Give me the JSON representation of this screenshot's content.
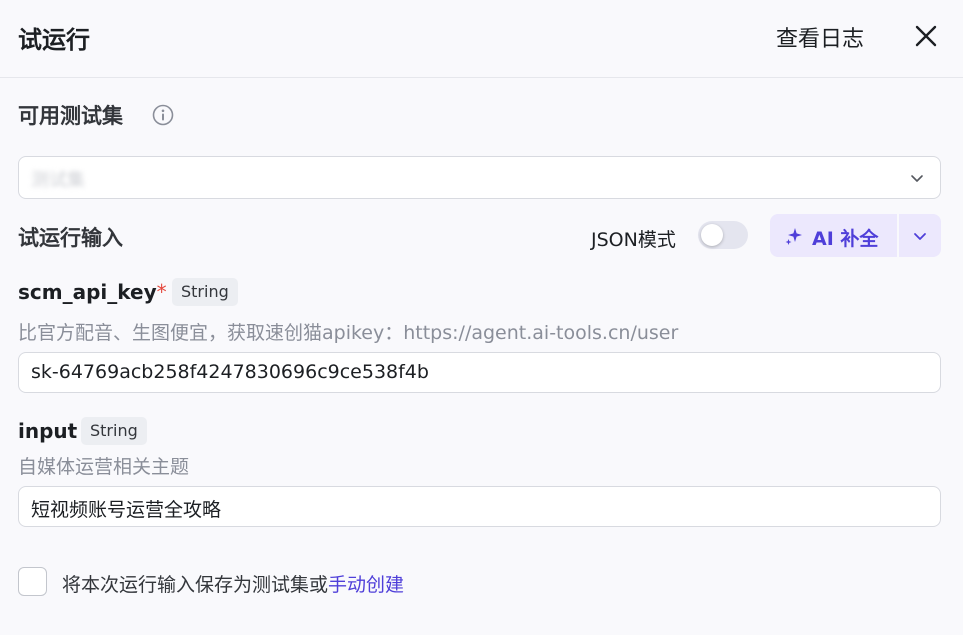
{
  "header": {
    "title": "试运行",
    "view_logs_label": "查看日志",
    "close_icon": "close-icon"
  },
  "test_set": {
    "label": "可用测试集",
    "info_icon": "info-icon",
    "selected_value": "测试集",
    "chevron_icon": "chevron-down-icon"
  },
  "run_input": {
    "label": "试运行输入",
    "json_mode_label": "JSON模式",
    "json_mode_on": false,
    "ai_fill_label": "AI 补全",
    "ai_fill_icon": "sparkle-icon",
    "ai_dropdown_icon": "chevron-down-icon"
  },
  "params": [
    {
      "name": "scm_api_key",
      "required_mark": "*",
      "type": "String",
      "description": "比官方配音、生图便宜，获取速创猫apikey：https://agent.ai-tools.cn/user",
      "value": "sk-64769acb258f4247830696c9ce538f4b"
    },
    {
      "name": "input",
      "type": "String",
      "description": "自媒体运营相关主题",
      "value": "短视频账号运营全攻略"
    }
  ],
  "footer": {
    "save_text": "将本次运行输入保存为测试集或",
    "manual_create_link": "手动创建",
    "checked": false
  },
  "colors": {
    "accent": "#4f3fd9",
    "ai_button_bg": "#ece8fd",
    "required": "#e5483e"
  }
}
